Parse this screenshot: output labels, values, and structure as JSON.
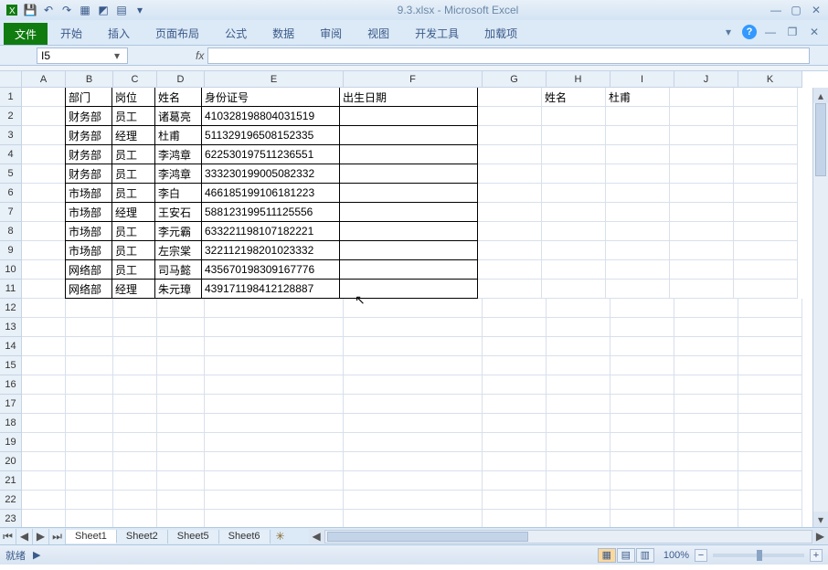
{
  "titlebar": {
    "filename": "9.3.xlsx",
    "app": "Microsoft Excel"
  },
  "ribbon": {
    "file": "文件",
    "tabs": [
      "开始",
      "插入",
      "页面布局",
      "公式",
      "数据",
      "审阅",
      "视图",
      "开发工具",
      "加载项"
    ]
  },
  "namebox": {
    "value": "I5"
  },
  "columns": [
    "A",
    "B",
    "C",
    "D",
    "E",
    "F",
    "G",
    "H",
    "I",
    "J",
    "K"
  ],
  "row_count": 23,
  "headers": {
    "B": "部门",
    "C": "岗位",
    "D": "姓名",
    "E": "身份证号",
    "F": "出生日期"
  },
  "table": [
    {
      "B": "财务部",
      "C": "员工",
      "D": "诸葛亮",
      "E": "410328198804031519"
    },
    {
      "B": "财务部",
      "C": "经理",
      "D": "杜甫",
      "E": "511329196508152335"
    },
    {
      "B": "财务部",
      "C": "员工",
      "D": "李鸿章",
      "E": "622530197511236551"
    },
    {
      "B": "财务部",
      "C": "员工",
      "D": "李鸿章",
      "E": "333230199005082332"
    },
    {
      "B": "市场部",
      "C": "员工",
      "D": "李白",
      "E": "466185199106181223"
    },
    {
      "B": "市场部",
      "C": "经理",
      "D": "王安石",
      "E": "588123199511125556"
    },
    {
      "B": "市场部",
      "C": "员工",
      "D": "李元霸",
      "E": "633221198107182221"
    },
    {
      "B": "市场部",
      "C": "员工",
      "D": "左宗棠",
      "E": "322112198201023332"
    },
    {
      "B": "网络部",
      "C": "员工",
      "D": "司马懿",
      "E": "435670198309167776"
    },
    {
      "B": "网络部",
      "C": "经理",
      "D": "朱元璋",
      "E": "439171198412128887"
    }
  ],
  "extra": {
    "H1": "姓名",
    "I1": "杜甫"
  },
  "sheets": {
    "list": [
      "Sheet1",
      "Sheet2",
      "Sheet5",
      "Sheet6"
    ],
    "active": 0
  },
  "status": {
    "ready": "就绪",
    "zoom": "100%"
  }
}
